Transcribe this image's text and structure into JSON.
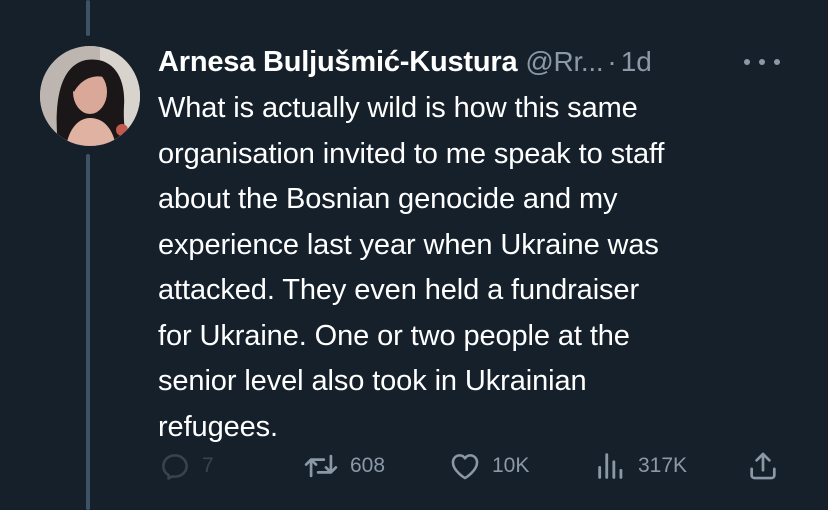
{
  "author": {
    "name": "Arnesa Buljušmić-Kustura",
    "handle": "@Rr...",
    "separator": "·",
    "time": "1d"
  },
  "tweet": {
    "text": "What is actually wild is how this same\norganisation invited to me speak to staff\nabout the Bosnian genocide and my\nexperience last year when Ukraine was\nattacked. They even held a fundraiser\nfor Ukraine. One or two people at the\nsenior level also took in Ukrainian\nrefugees."
  },
  "actions": {
    "replies": "7",
    "retweets": "608",
    "likes": "10K",
    "views": "317K"
  },
  "icons": {
    "reply": "reply-icon",
    "retweet": "retweet-icon",
    "like": "heart-icon",
    "views": "views-icon",
    "share": "share-icon",
    "more": "more-icon"
  },
  "colors": {
    "background": "#15202b",
    "text": "#ffffff",
    "secondary": "#8b98a5",
    "thread_line": "#3d5466"
  }
}
